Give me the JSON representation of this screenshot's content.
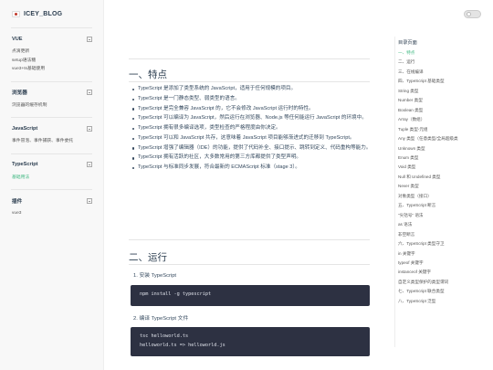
{
  "brand": {
    "title": "ICEY_BLOG"
  },
  "sidebar": {
    "groups": [
      {
        "title": "VUE",
        "items": [
          "点滴更新",
          "setup语法糖",
          "vue3+ts基础使用"
        ]
      },
      {
        "title": "浏览器",
        "items": [
          "浏览器的缓存机制"
        ]
      },
      {
        "title": "JavaScript",
        "items": [
          "事件冒泡、事件捕获、事件委托"
        ]
      },
      {
        "title": "TypeScript",
        "items": [
          "基础用法"
        ]
      },
      {
        "title": "插件",
        "items": [
          "vue3"
        ]
      }
    ]
  },
  "main": {
    "section1": {
      "title": "一、特点"
    },
    "bullets": [
      "TypeScript 是添加了类型系统的 JavaScript，适用于任何规模的项目。",
      "TypeScript 是一门静态类型、弱类型的语言。",
      "TypeScript 是完全兼容 JavaScript 的，它不会修改 JavaScript 运行时的特性。",
      "TypeScript 可以编译为 JavaScript，然后运行在浏览器、Node.js 等任何能运行 JavaScript 的环境中。",
      "TypeScript 拥有很多编译选项，类型检查的严格程度由你决定。",
      "TypeScript 可以和 JavaScript 共存，这意味着 JavaScript 项目能够渐进式的迁移到 TypeScript。",
      "TypeScript 增强了编辑器（IDE）的功能，提供了代码补全、接口提示、跳转到定义、代码重构等能力。",
      "TypeScript 拥有活跃的社区，大多数常用的第三方库都提供了类型声明。",
      "TypeScript 与标准同步发展，符合最新的 ECMAScript 标准（stage 3）。"
    ],
    "section2": {
      "title": "二、运行"
    },
    "step1": "1. 安装 TypeScript",
    "code1": [
      "npm install -g typescript"
    ],
    "step2": "2. 编译 TypeScript 文件",
    "code2": [
      "tsc helloworld.ts",
      "helloworld.ts => helloworld.js"
    ]
  },
  "toc": {
    "title": "目录页面",
    "items": [
      "一、特点",
      "二、运行",
      "三、在线编译",
      "四、TypeScript 基础类型",
      "String 类型",
      "Number 类型",
      "Boolean 类型",
      "Array（数组）",
      "Tuple 类型-元组",
      "Any 类型（任意类型/全局超级类",
      "Unknown 类型",
      "Enum 类型",
      "Void 类型",
      "Null 和 Undefined 类型",
      "Never 类型",
      "对象类型（接口）",
      "五、TypeScript 断言",
      "\"尖括号\" 语法",
      "as 语法",
      "非空断言",
      "六、TypeScript 类型守卫",
      "in 关键字",
      "typeof 关键字",
      "instanceof 关键字",
      "自定义类型保护的类型谓词",
      "七、TypeScript 联合类型",
      "八、TypeScript 泛型"
    ]
  }
}
